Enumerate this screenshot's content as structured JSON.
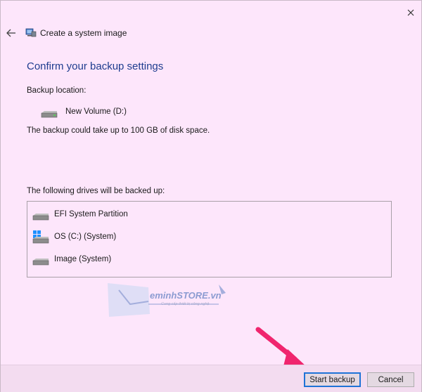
{
  "window": {
    "close_icon": "close-icon",
    "back_icon": "back-arrow-icon",
    "app_icon": "system-image-icon",
    "app_title": "Create a system image"
  },
  "main": {
    "heading": "Confirm your backup settings",
    "backup_location_label": "Backup location:",
    "backup_location_drive": "New Volume (D:)",
    "space_note": "The backup could take up to 100 GB of disk space.",
    "drives_label": "The following drives will be backed up:",
    "drives": [
      {
        "name": "EFI System Partition",
        "icon": "drive-icon"
      },
      {
        "name": "OS (C:) (System)",
        "icon": "windows-drive-icon"
      },
      {
        "name": "Image (System)",
        "icon": "drive-icon"
      }
    ]
  },
  "watermark": {
    "text": "eminhSTORE.vn",
    "subtext": "Cung cấp thiết bị công nghệ"
  },
  "footer": {
    "start_label": "Start backup",
    "cancel_label": "Cancel"
  },
  "colors": {
    "background": "#fde6fb",
    "heading": "#1e3d8f",
    "primary_border": "#1f73d7",
    "annotation_arrow": "#f0256e"
  }
}
